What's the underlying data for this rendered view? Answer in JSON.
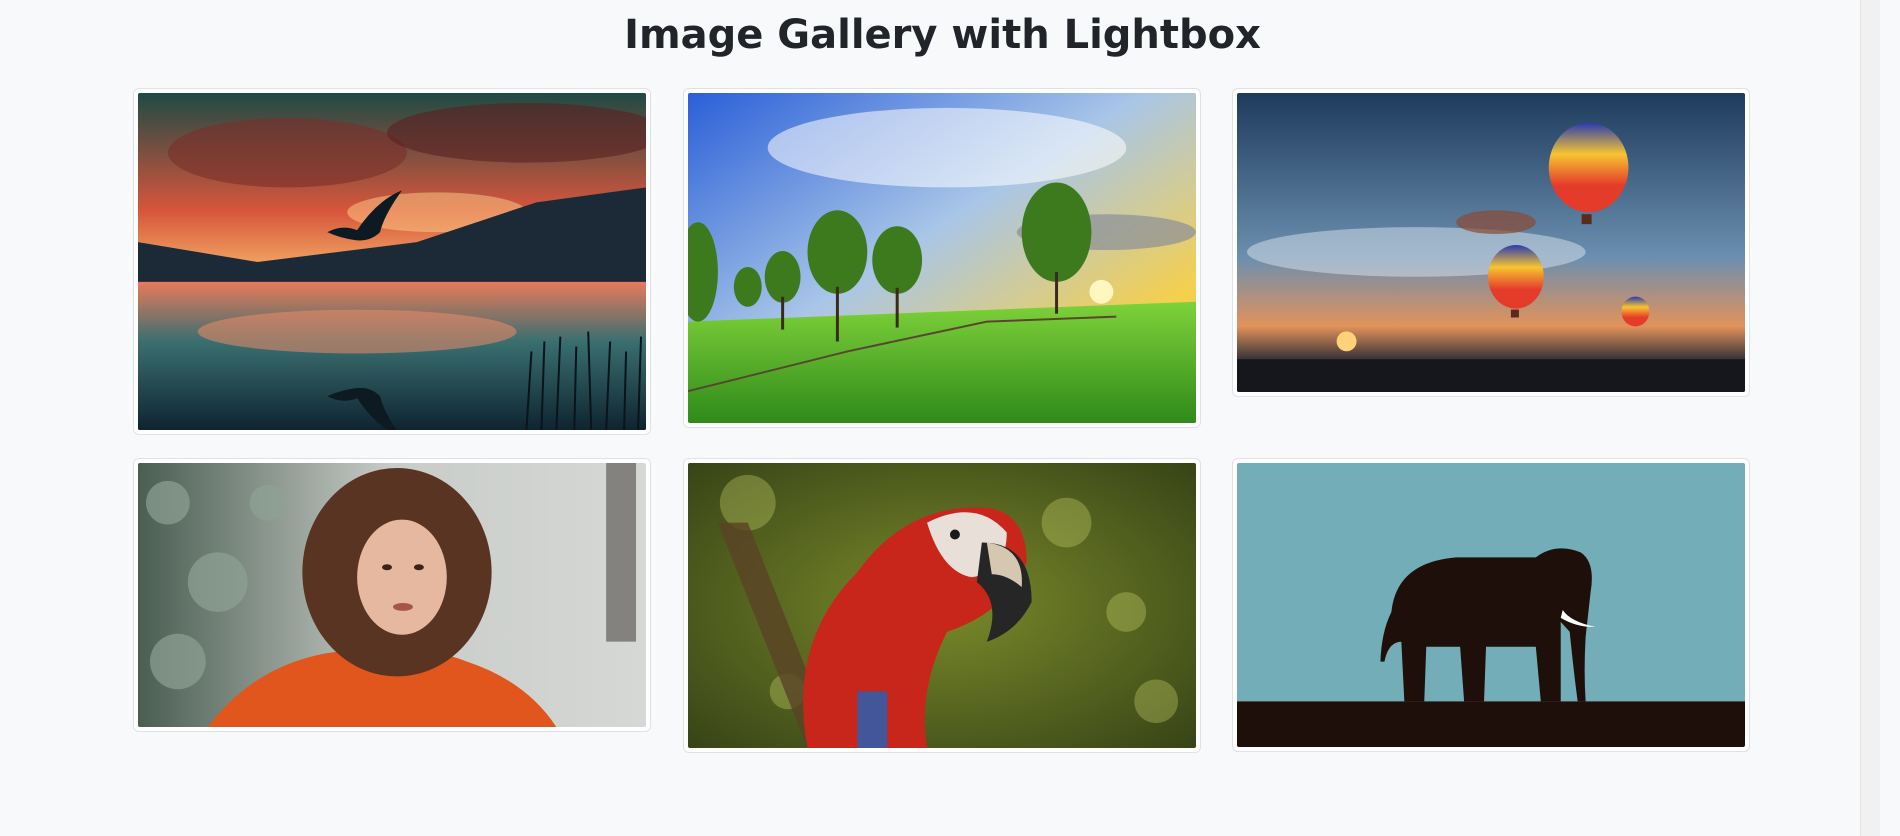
{
  "page": {
    "title": "Image Gallery with Lightbox"
  },
  "gallery": {
    "images": [
      {
        "subject": "bird flying over lake at red sunset"
      },
      {
        "subject": "trees on green meadow at sunrise"
      },
      {
        "subject": "hot air balloons in evening sky"
      },
      {
        "subject": "woman with curly hair in orange jacket"
      },
      {
        "subject": "red macaw parrot"
      },
      {
        "subject": "elephant silhouette on teal background"
      }
    ]
  },
  "colors": {
    "background": "#f8f9fa",
    "title": "#212529",
    "thumbnail_border": "#dee2e6"
  }
}
